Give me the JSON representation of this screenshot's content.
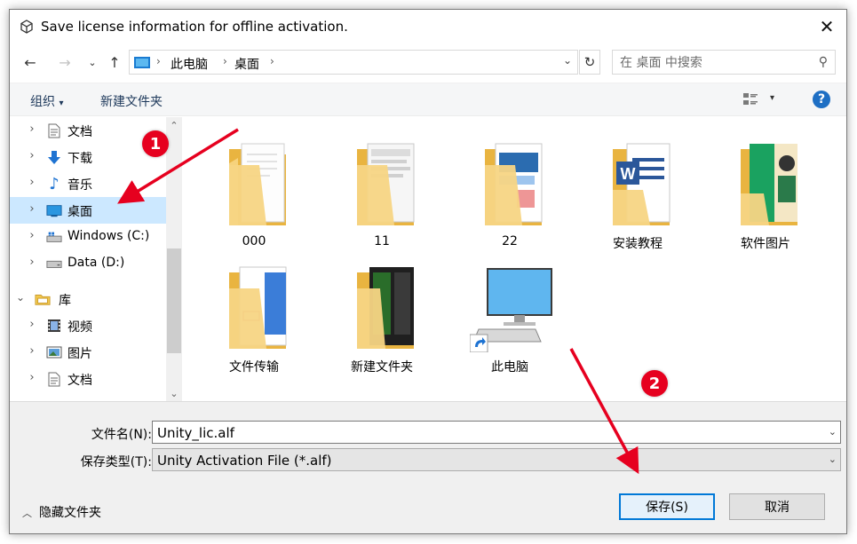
{
  "window": {
    "title": "Save license information for offline activation."
  },
  "address": {
    "segments": [
      "此电脑",
      "桌面"
    ],
    "search_placeholder": "在 桌面 中搜索"
  },
  "toolbar": {
    "organize": "组织",
    "new_folder": "新建文件夹"
  },
  "sidebar": {
    "items": [
      {
        "label": "文档",
        "icon": "document-icon"
      },
      {
        "label": "下载",
        "icon": "download-icon"
      },
      {
        "label": "音乐",
        "icon": "music-icon"
      },
      {
        "label": "桌面",
        "icon": "desktop-icon",
        "selected": true
      },
      {
        "label": "Windows (C:)",
        "icon": "drive-icon"
      },
      {
        "label": "Data (D:)",
        "icon": "drive-icon"
      },
      {
        "label": "库",
        "icon": "library-icon",
        "expanded": true
      },
      {
        "label": "视频",
        "icon": "video-icon"
      },
      {
        "label": "图片",
        "icon": "picture-icon"
      },
      {
        "label": "文档",
        "icon": "document-icon"
      }
    ]
  },
  "files": [
    {
      "name": "000",
      "type": "folder"
    },
    {
      "name": "11",
      "type": "folder"
    },
    {
      "name": "22",
      "type": "folder"
    },
    {
      "name": "安装教程",
      "type": "folder"
    },
    {
      "name": "软件图片",
      "type": "folder"
    },
    {
      "name": "文件传输",
      "type": "folder"
    },
    {
      "name": "新建文件夹",
      "type": "folder"
    },
    {
      "name": "此电脑",
      "type": "shortcut"
    }
  ],
  "form": {
    "filename_label": "文件名(N):",
    "filename_value": "Unity_lic.alf",
    "filetype_label": "保存类型(T):",
    "filetype_value": "Unity Activation File (*.alf)"
  },
  "footer": {
    "hide_folders": "隐藏文件夹",
    "save_button": "保存(S)",
    "cancel_button": "取消"
  },
  "annotations": {
    "badge1": "1",
    "badge2": "2",
    "color": "#e6001f"
  }
}
